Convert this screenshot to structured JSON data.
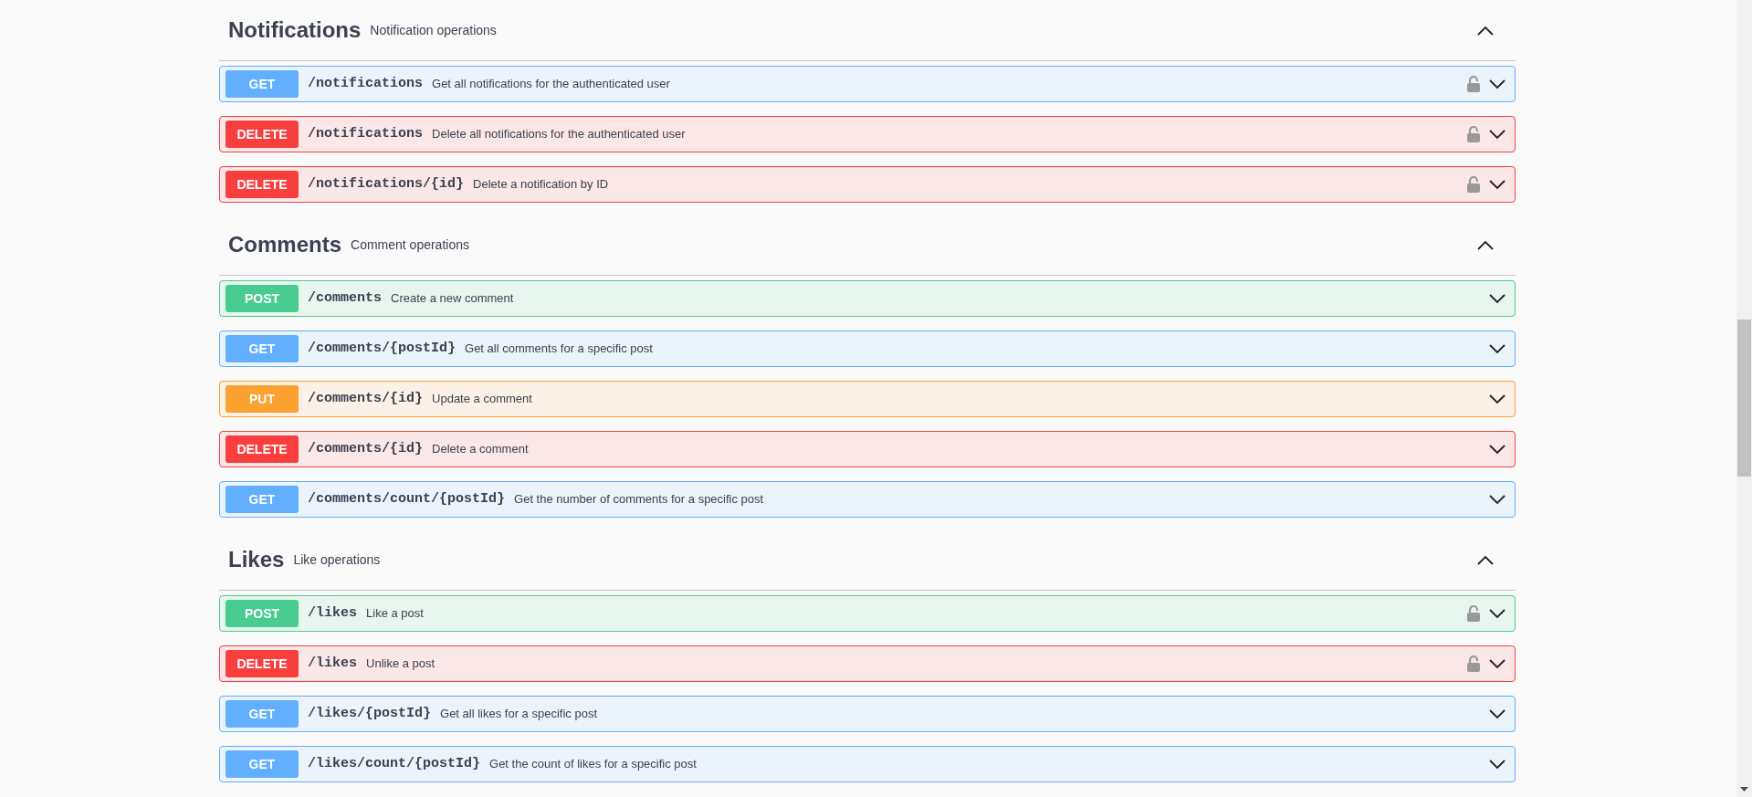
{
  "sections": [
    {
      "name": "Notifications",
      "description": "Notification operations",
      "expanded": true,
      "operations": [
        {
          "method": "GET",
          "path": "/notifications",
          "summary": "Get all notifications for the authenticated user",
          "secured": true
        },
        {
          "method": "DELETE",
          "path": "/notifications",
          "summary": "Delete all notifications for the authenticated user",
          "secured": true
        },
        {
          "method": "DELETE",
          "path": "/notifications/{id}",
          "summary": "Delete a notification by ID",
          "secured": true
        }
      ]
    },
    {
      "name": "Comments",
      "description": "Comment operations",
      "expanded": true,
      "operations": [
        {
          "method": "POST",
          "path": "/comments",
          "summary": "Create a new comment",
          "secured": false
        },
        {
          "method": "GET",
          "path": "/comments/{postId}",
          "summary": "Get all comments for a specific post",
          "secured": false
        },
        {
          "method": "PUT",
          "path": "/comments/{id}",
          "summary": "Update a comment",
          "secured": false
        },
        {
          "method": "DELETE",
          "path": "/comments/{id}",
          "summary": "Delete a comment",
          "secured": false
        },
        {
          "method": "GET",
          "path": "/comments/count/{postId}",
          "summary": "Get the number of comments for a specific post",
          "secured": false
        }
      ]
    },
    {
      "name": "Likes",
      "description": "Like operations",
      "expanded": true,
      "operations": [
        {
          "method": "POST",
          "path": "/likes",
          "summary": "Like a post",
          "secured": true
        },
        {
          "method": "DELETE",
          "path": "/likes",
          "summary": "Unlike a post",
          "secured": true
        },
        {
          "method": "GET",
          "path": "/likes/{postId}",
          "summary": "Get all likes for a specific post",
          "secured": false
        },
        {
          "method": "GET",
          "path": "/likes/count/{postId}",
          "summary": "Get the count of likes for a specific post",
          "secured": false
        }
      ]
    }
  ]
}
